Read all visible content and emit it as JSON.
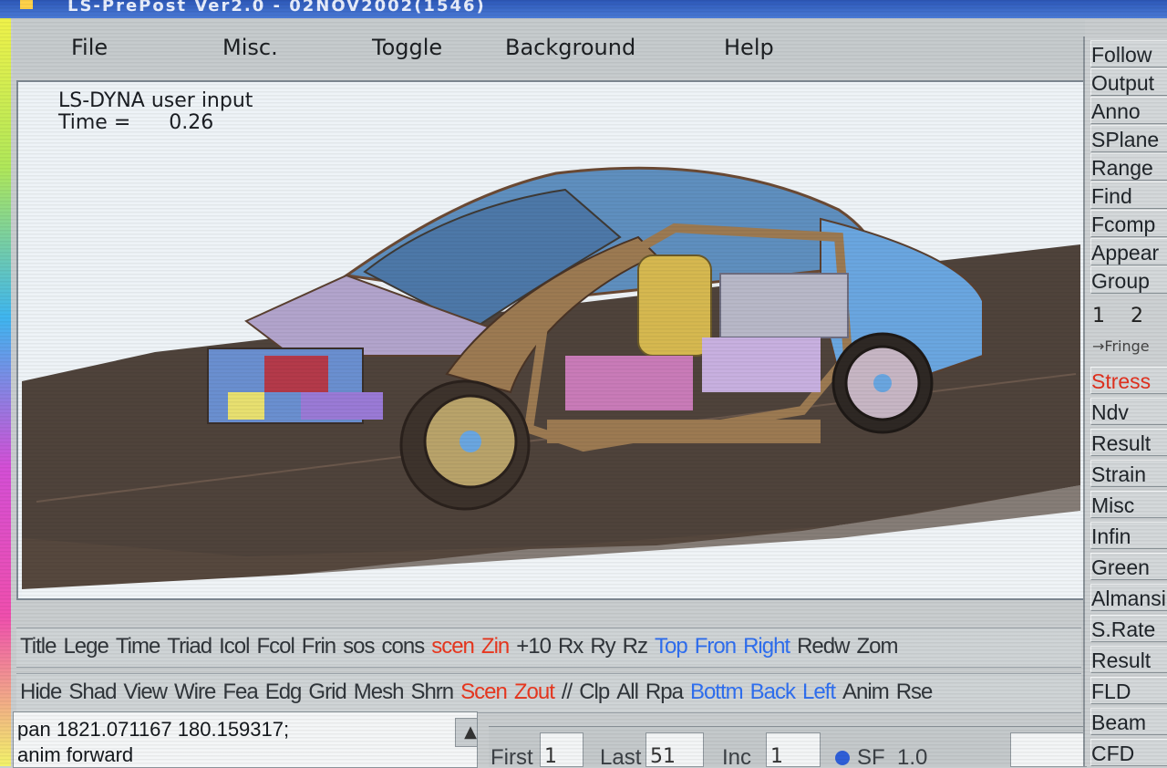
{
  "window": {
    "title": "LS-PrePost Ver2.0 - 02NOV2002(1546)"
  },
  "menu": [
    "File",
    "Misc.",
    "Toggle",
    "Background",
    "Help"
  ],
  "viewport": {
    "line1": "LS-DYNA user input",
    "time_label": "Time =",
    "time_value": "0.26"
  },
  "toolbar_row1": [
    {
      "label": "Title",
      "color": "normal"
    },
    {
      "label": "Lege",
      "color": "normal"
    },
    {
      "label": "Time",
      "color": "normal"
    },
    {
      "label": "Triad",
      "color": "normal"
    },
    {
      "label": "Icol",
      "color": "normal"
    },
    {
      "label": "Fcol",
      "color": "normal"
    },
    {
      "label": "Frin",
      "color": "normal"
    },
    {
      "label": "sos",
      "color": "normal"
    },
    {
      "label": "cons",
      "color": "normal"
    },
    {
      "label": "scen",
      "color": "red"
    },
    {
      "label": "Zin",
      "color": "red"
    },
    {
      "label": "+10",
      "color": "normal"
    },
    {
      "label": "Rx",
      "color": "normal"
    },
    {
      "label": "Ry",
      "color": "normal"
    },
    {
      "label": "Rz",
      "color": "normal"
    },
    {
      "label": "Top",
      "color": "blue"
    },
    {
      "label": "Fron",
      "color": "blue"
    },
    {
      "label": "Right",
      "color": "blue"
    },
    {
      "label": "Redw",
      "color": "normal"
    },
    {
      "label": "Zom",
      "color": "normal"
    }
  ],
  "toolbar_row2": [
    {
      "label": "Hide",
      "color": "normal"
    },
    {
      "label": "Shad",
      "color": "normal"
    },
    {
      "label": "View",
      "color": "normal"
    },
    {
      "label": "Wire",
      "color": "normal"
    },
    {
      "label": "Fea",
      "color": "normal"
    },
    {
      "label": "Edg",
      "color": "normal"
    },
    {
      "label": "Grid",
      "color": "normal"
    },
    {
      "label": "Mesh",
      "color": "normal"
    },
    {
      "label": "Shrn",
      "color": "normal"
    },
    {
      "label": "Scen",
      "color": "red"
    },
    {
      "label": "Zout",
      "color": "red"
    },
    {
      "label": "//",
      "color": "normal"
    },
    {
      "label": "Clp",
      "color": "normal"
    },
    {
      "label": "All",
      "color": "normal"
    },
    {
      "label": "Rpa",
      "color": "normal"
    },
    {
      "label": "Bottm",
      "color": "blue"
    },
    {
      "label": "Back",
      "color": "blue"
    },
    {
      "label": "Left",
      "color": "blue"
    },
    {
      "label": "Anim",
      "color": "normal"
    },
    {
      "label": "Rse",
      "color": "normal"
    }
  ],
  "console": {
    "line1": "pan 1821.071167 180.159317;",
    "line2": "anim forward"
  },
  "anim": {
    "first_label": "First",
    "first_value": "1",
    "last_label": "Last",
    "last_value": "51",
    "inc_label": "Inc",
    "inc_value": "1",
    "sf_label": "SF",
    "sf_value": "1.0"
  },
  "sidepanel": {
    "top_buttons": [
      "Follow",
      "Output",
      "Anno",
      "SPlane",
      "Range",
      "Find",
      "Fcomp",
      "Appear",
      "Group"
    ],
    "page_nums": [
      "1",
      "2"
    ],
    "fringe_label": "Fringe",
    "bottom_buttons": [
      {
        "label": "Stress",
        "color": "red"
      },
      {
        "label": "Ndv",
        "color": "normal"
      },
      {
        "label": "Result",
        "color": "normal"
      },
      {
        "label": "Strain",
        "color": "normal"
      },
      {
        "label": "Misc",
        "color": "normal"
      },
      {
        "label": "Infin",
        "color": "normal"
      },
      {
        "label": "Green",
        "color": "normal"
      },
      {
        "label": "Almansi",
        "color": "normal"
      },
      {
        "label": "S.Rate",
        "color": "normal"
      },
      {
        "label": "Result",
        "color": "normal"
      },
      {
        "label": "FLD",
        "color": "normal"
      },
      {
        "label": "Beam",
        "color": "normal"
      },
      {
        "label": "CFD",
        "color": "normal"
      }
    ]
  },
  "colors": {
    "red_button": "#e8371f",
    "blue_button": "#2f6ff0",
    "viewport_bg": "#eef3f7",
    "road": "#4f433b",
    "car_body": "#6aa6e0"
  }
}
